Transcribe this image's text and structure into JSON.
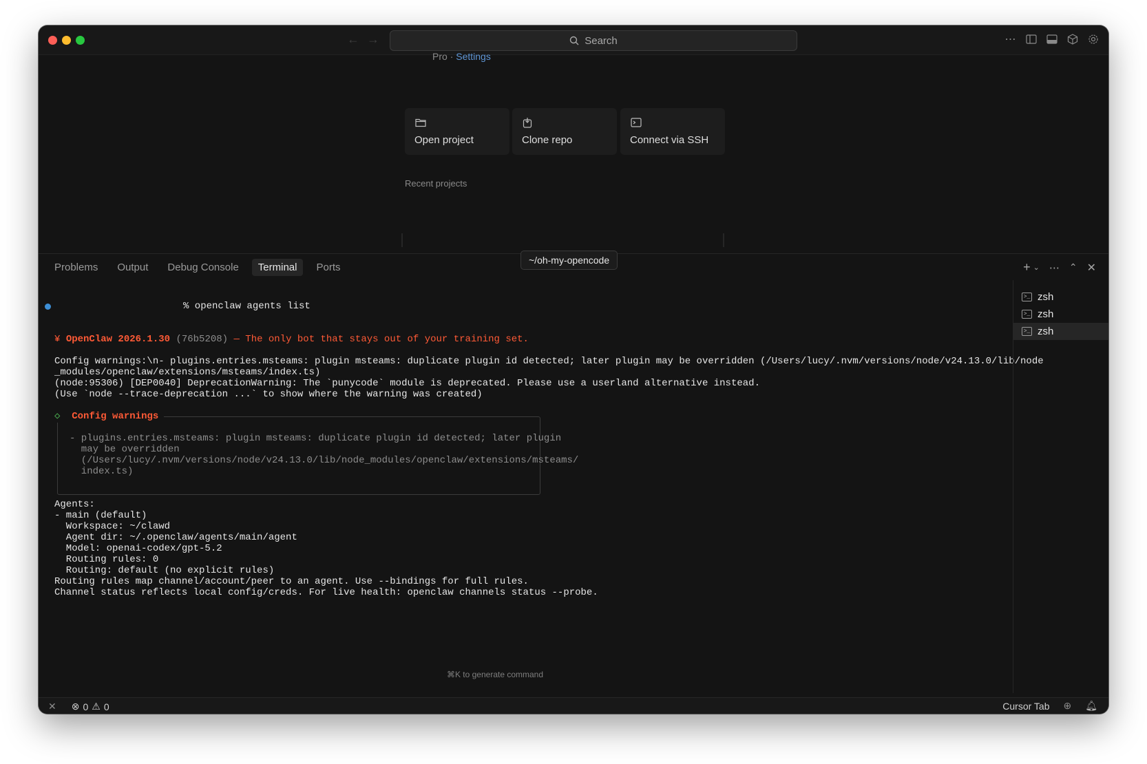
{
  "titlebar": {
    "search_placeholder": "Search"
  },
  "welcome": {
    "breadcrumb_plan": "Pro",
    "breadcrumb_separator": "·",
    "breadcrumb_settings": "Settings",
    "cards": [
      {
        "label": "Open project",
        "icon": "folder-icon"
      },
      {
        "label": "Clone repo",
        "icon": "clone-icon"
      },
      {
        "label": "Connect via SSH",
        "icon": "terminal-icon"
      }
    ],
    "recent_label": "Recent projects"
  },
  "panel": {
    "tabs": [
      "Problems",
      "Output",
      "Debug Console",
      "Terminal",
      "Ports"
    ],
    "active_tab": "Terminal",
    "tooltip": "~/oh-my-opencode"
  },
  "terminal": {
    "prompt": "% openclaw agents list",
    "banner_name": "OpenClaw 2026.1.30",
    "banner_hash": "(76b5208)",
    "banner_tagline": "— The only bot that stays out of your training set.",
    "warn_line1": "Config warnings:\\n- plugins.entries.msteams: plugin msteams: duplicate plugin id detected; later plugin may be overridden (/Users/lucy/.nvm/versions/node/v24.13.0/lib/node",
    "warn_line2": "_modules/openclaw/extensions/msteams/index.ts)",
    "warn_line3": "(node:95306) [DEP0040] DeprecationWarning: The `punycode` module is deprecated. Please use a userland alternative instead.",
    "warn_line4": "(Use `node --trace-deprecation ...` to show where the warning was created)",
    "box_title": "Config warnings",
    "box_lines": [
      "- plugins.entries.msteams: plugin msteams: duplicate plugin id detected; later plugin",
      "  may be overridden",
      "  (/Users/lucy/.nvm/versions/node/v24.13.0/lib/node_modules/openclaw/extensions/msteams/",
      "  index.ts)"
    ],
    "agents_lines": [
      "Agents:",
      "- main (default)",
      "  Workspace: ~/clawd",
      "  Agent dir: ~/.openclaw/agents/main/agent",
      "  Model: openai-codex/gpt-5.2",
      "  Routing rules: 0",
      "  Routing: default (no explicit rules)",
      "Routing rules map channel/account/peer to an agent. Use --bindings for full rules.",
      "Channel status reflects local config/creds. For live health: openclaw channels status --probe."
    ],
    "hint": "⌘K to generate command"
  },
  "sessions": [
    "zsh",
    "zsh",
    "zsh"
  ],
  "statusbar": {
    "errors": "0",
    "warnings": "0",
    "cursor_tab": "Cursor Tab"
  }
}
